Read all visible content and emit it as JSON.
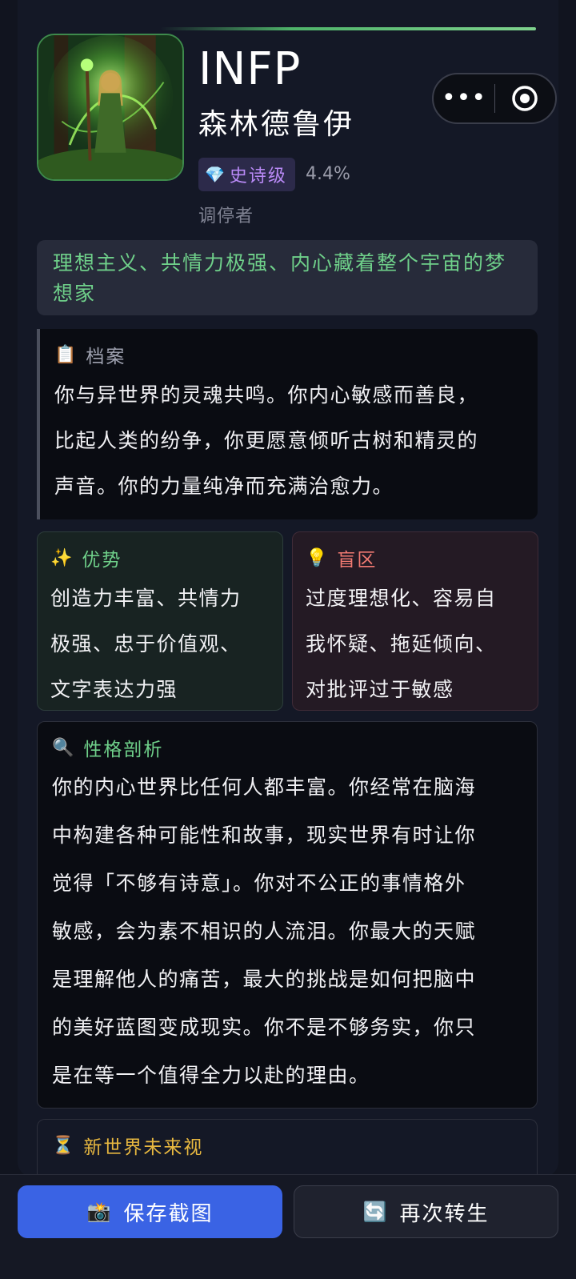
{
  "result": {
    "type_code": "INFP",
    "type_name": "森林德鲁伊",
    "rarity_icon": "gem-icon",
    "rarity": "史诗级",
    "percentage": "4.4%",
    "role": "调停者",
    "tagline": "理想主义、共情力极强、内心藏着整个宇宙的梦想家"
  },
  "capsule": {
    "more_icon": "more-dots-icon",
    "close_icon": "target-circle-icon"
  },
  "profile": {
    "icon": "clipboard-icon",
    "title": "档案",
    "text": [
      "你与异世界的灵魂共鸣。你内心敏感而善良，",
      "比起人类的纷争，你更愿意倾听古树和精灵的",
      "声音。你的力量纯净而充满治愈力。"
    ]
  },
  "strengths": {
    "icon": "sparkles-icon",
    "title": "优势",
    "text": [
      "创造力丰富、共情力",
      "极强、忠于价值观、",
      "文字表达力强"
    ]
  },
  "blindspots": {
    "icon": "lightbulb-icon",
    "title": "盲区",
    "text": [
      "过度理想化、容易自",
      "我怀疑、拖延倾向、",
      "对批评过于敏感"
    ]
  },
  "analysis": {
    "icon": "magnifier-icon",
    "title": "性格剖析",
    "text": [
      "你的内心世界比任何人都丰富。你经常在脑海",
      "中构建各种可能性和故事，现实世界有时让你",
      "觉得「不够有诗意」。你对不公正的事情格外",
      "敏感，会为素不相识的人流泪。你最大的天赋",
      "是理解他人的痛苦，最大的挑战是如何把脑中",
      "的美好蓝图变成现实。你不是不够务实，你只",
      "是在等一个值得全力以赴的理由。"
    ]
  },
  "future": {
    "icon": "hourglass-icon",
    "title": "新世界未来视"
  },
  "actions": {
    "save_icon": "camera-flash-icon",
    "save_label": "保存截图",
    "rebirth_icon": "refresh-icon",
    "rebirth_label": "再次转生"
  },
  "colors": {
    "background": "#11141f",
    "accent_green": "#6fd08a",
    "rarity_purple": "#b889f5",
    "blindspot_red": "#f17a72",
    "future_gold": "#e8b840",
    "primary_button": "#3a63e4"
  }
}
